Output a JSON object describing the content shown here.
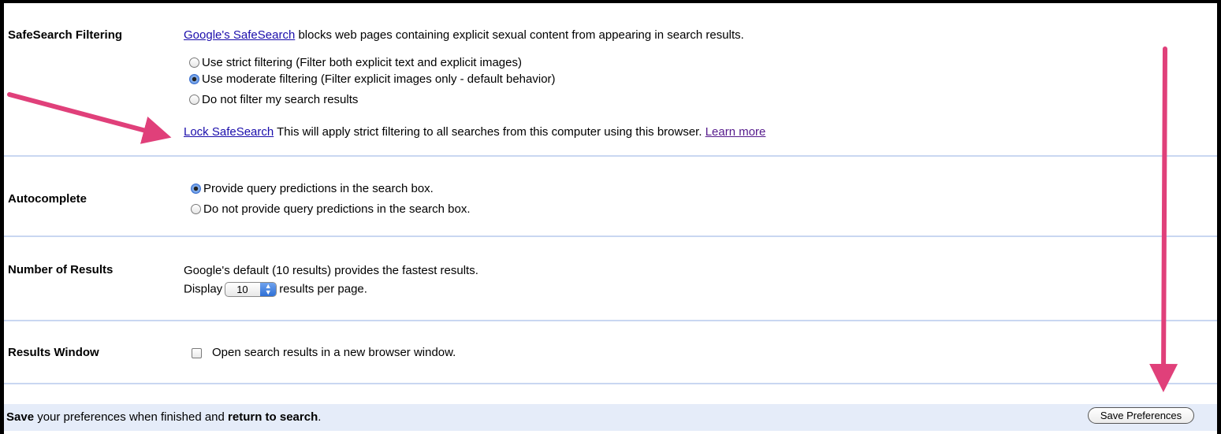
{
  "safesearch": {
    "label": "SafeSearch Filtering",
    "intro_link": "Google's SafeSearch",
    "intro_text": " blocks web pages containing explicit sexual content from appearing in search results.",
    "options": [
      {
        "label": "Use strict filtering (Filter both explicit text and explicit images)",
        "selected": false
      },
      {
        "label": "Use moderate filtering (Filter explicit images only - default behavior)",
        "selected": true
      },
      {
        "label": "Do not filter my search results",
        "selected": false
      }
    ],
    "lock_link": "Lock SafeSearch",
    "lock_text": " This will apply strict filtering to all searches from this computer using this browser. ",
    "learn_more": "Learn more"
  },
  "autocomplete": {
    "label": "Autocomplete",
    "options": [
      {
        "label": "Provide query predictions in the search box.",
        "selected": true
      },
      {
        "label": "Do not provide query predictions in the search box.",
        "selected": false
      }
    ]
  },
  "results": {
    "label": "Number of Results",
    "note": "Google's default (10 results) provides the fastest results.",
    "display_prefix": "Display",
    "display_value": "10",
    "display_suffix": "results per page."
  },
  "window": {
    "label": "Results Window",
    "checkbox_label": "Open search results in a new browser window.",
    "checked": false
  },
  "footer": {
    "save_word": "Save",
    "mid_text": " your preferences when finished and ",
    "return_text": "return to search",
    "end": ".",
    "button": "Save Preferences"
  },
  "colors": {
    "annotation_arrow": "#e0407a",
    "link": "#1a0dab",
    "separator": "#c9d7f1",
    "footer_bg": "#e5ecf9"
  },
  "icons": [
    "radio-icon",
    "checkbox-icon",
    "dropdown-arrow-icon",
    "annotation-arrow-icon"
  ]
}
